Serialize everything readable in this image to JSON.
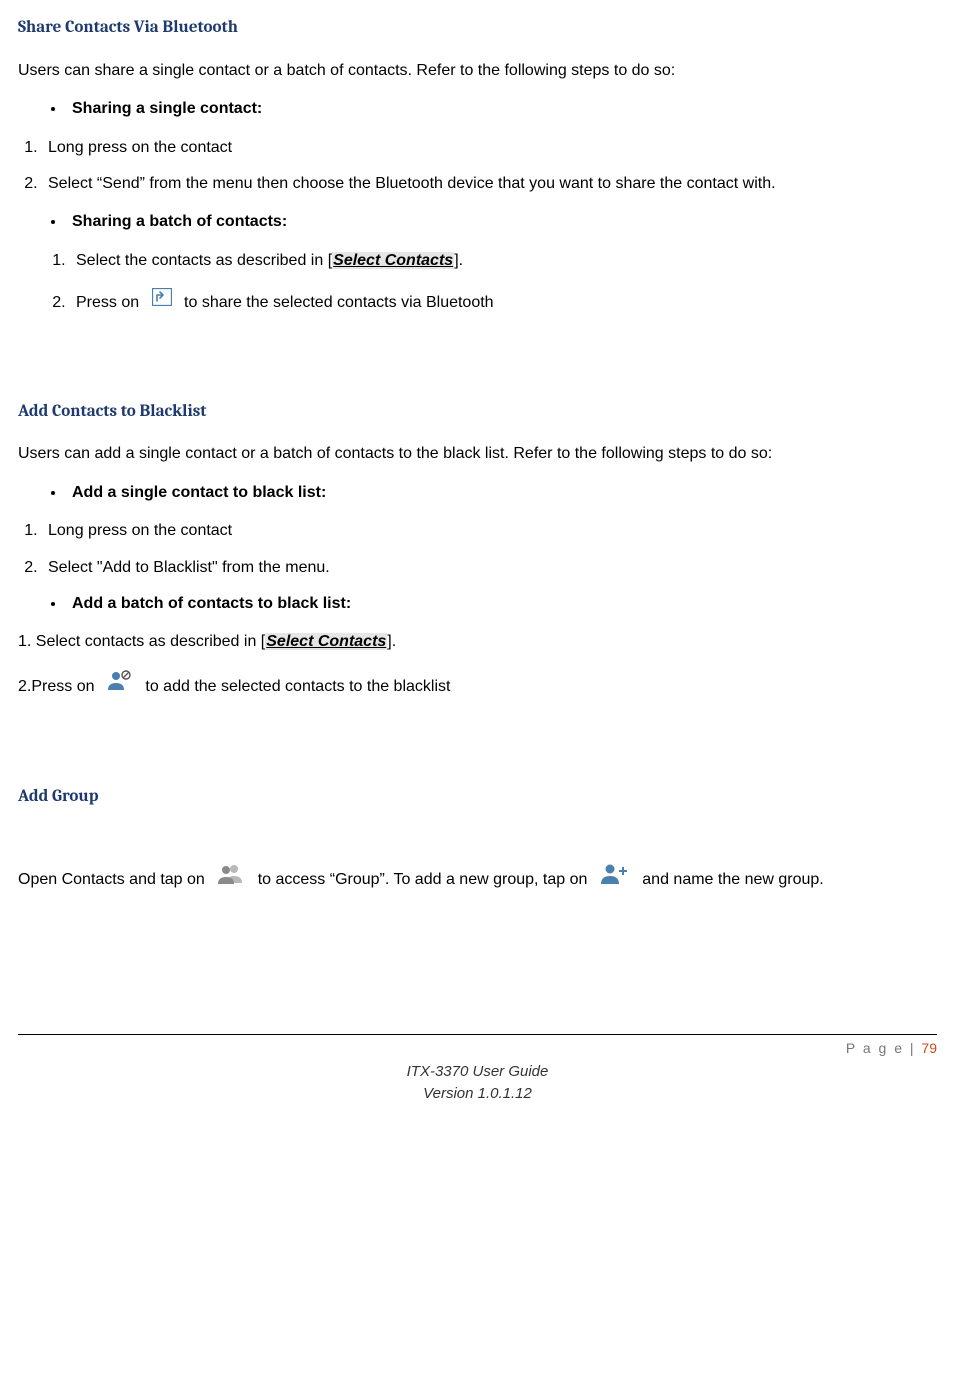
{
  "section1": {
    "title": "Share Contacts Via Bluetooth",
    "intro": "Users can share a single contact or a batch of contacts. Refer to the following steps to do so:",
    "bullet1": "Sharing a single contact:",
    "step1": "Long press on the contact",
    "step2": "Select “Send” from the menu then choose the Bluetooth device that you want to share the contact with.",
    "bullet2": "Sharing a batch of contacts:",
    "batch_step1_pre": "Select the contacts as described in [",
    "batch_step1_ref": "Select Contacts",
    "batch_step1_post": "].",
    "batch_step2_pre": "Press on ",
    "batch_step2_post": " to share the selected contacts via Bluetooth"
  },
  "section2": {
    "title": "Add Contacts to Blacklist",
    "intro": "Users can add a single contact or a batch of contacts to the black list. Refer to the following steps to do so:",
    "bullet1": "Add a single contact to black list:",
    "step1": "Long press on the contact",
    "step2": "Select \"Add to Blacklist\" from the menu.",
    "bullet2": "Add a batch of contacts to black list:",
    "batch_step1_pre": "1. Select contacts as described in [",
    "batch_step1_ref": "Select Contacts",
    "batch_step1_post": "].",
    "batch_step2_pre": "2.Press on ",
    "batch_step2_post": " to add the selected contacts to the blacklist"
  },
  "section3": {
    "title": "Add Group",
    "text_pre": "Open Contacts and tap on ",
    "text_mid": " to access “Group”. To add a new group, tap on ",
    "text_post": " and name the new group."
  },
  "footer": {
    "page_label": "P a g e | ",
    "page_num": "79",
    "line1": "ITX-3370 User Guide",
    "line2": "Version 1.0.1.12"
  }
}
